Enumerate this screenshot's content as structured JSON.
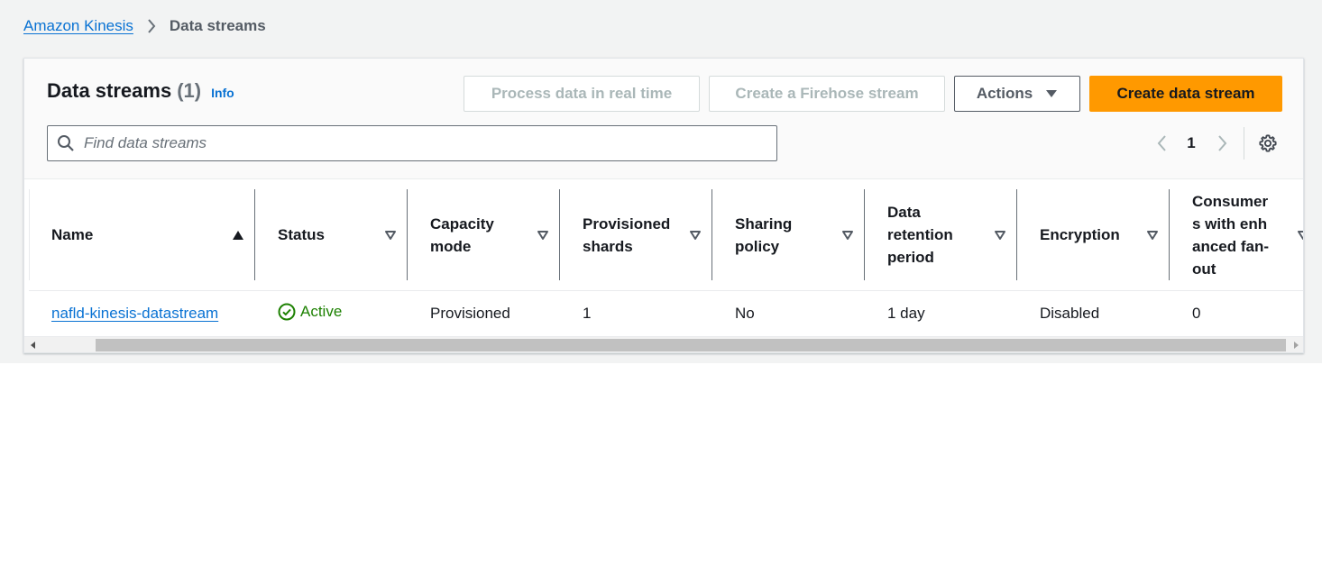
{
  "breadcrumb": {
    "root": "Amazon Kinesis",
    "current": "Data streams"
  },
  "header": {
    "title": "Data streams",
    "count": "(1)",
    "info": "Info"
  },
  "buttons": {
    "process": "Process data in real time",
    "firehose": "Create a Firehose stream",
    "actions": "Actions",
    "create": "Create data stream"
  },
  "search": {
    "placeholder": "Find data streams",
    "value": ""
  },
  "pagination": {
    "current_page": "1"
  },
  "table": {
    "columns": [
      {
        "label": "Name",
        "sort": "ascending"
      },
      {
        "label": "Status",
        "sort": "none"
      },
      {
        "label": "Capacity mode",
        "sort": "none"
      },
      {
        "label": "Provisioned shards",
        "sort": "none"
      },
      {
        "label": "Sharing policy",
        "sort": "none"
      },
      {
        "label": "Data retention period",
        "sort": "none"
      },
      {
        "label": "Encryption",
        "sort": "none"
      },
      {
        "label": "Consumers with enhanced fan-out",
        "sort": "none"
      }
    ],
    "rows": [
      {
        "name": "nafld-kinesis-datastream",
        "status": "Active",
        "capacity_mode": "Provisioned",
        "provisioned_shards": "1",
        "sharing_policy": "No",
        "retention": "1 day",
        "encryption": "Disabled",
        "consumers": "0"
      }
    ]
  },
  "colors": {
    "link": "#0972d3",
    "primary": "#ff9900",
    "status_active": "#1d8102",
    "background": "#f2f3f3"
  },
  "icons": {
    "breadcrumb_separator": "chevron-right-icon",
    "search": "search-icon",
    "actions_caret": "caret-down-icon",
    "sort_asc": "sort-ascending-icon",
    "sort_none": "sort-icon",
    "status_active": "check-circle-icon",
    "pager_prev": "chevron-left-icon",
    "pager_next": "chevron-right-icon",
    "settings": "gear-icon"
  }
}
